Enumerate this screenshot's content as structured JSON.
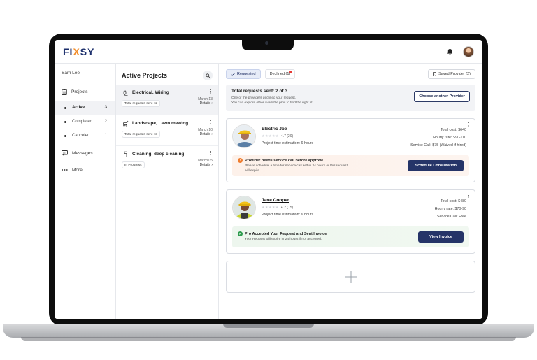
{
  "app": {
    "logo_left": "FI",
    "logo_x": "X",
    "logo_right": "SY",
    "accent": "#f28c28",
    "brand": "#1b2e6b"
  },
  "header": {
    "bell_icon": "bell-icon",
    "avatar_icon": "user-avatar"
  },
  "sidebar": {
    "user": "Sam Lee",
    "projects_label": "Projects",
    "statuses": [
      {
        "label": "Active",
        "count": "3"
      },
      {
        "label": "Completed",
        "count": "2"
      },
      {
        "label": "Canceled",
        "count": "1"
      }
    ],
    "messages_label": "Messages",
    "more_label": "More"
  },
  "projects": {
    "title": "Active Projects",
    "items": [
      {
        "name": "Electrical, Wiring",
        "date": "March 13",
        "chip": "Total requests sent : 2",
        "details": "Details"
      },
      {
        "name": "Landscape, Lawn mewing",
        "date": "March 10",
        "chip": "Total requests sent : 3",
        "details": "Details"
      },
      {
        "name": "Cleaning, deep cleaning",
        "date": "March 05",
        "chip": "In Progress",
        "details": "Details"
      }
    ]
  },
  "main": {
    "tabs": {
      "requested": "Requested",
      "declined": "Declined (1)",
      "saved": "Saved Provider (2)"
    },
    "banner": {
      "title": "Total requests sent: 2 of 3",
      "line1": "One of the providers declined your request.",
      "line2": "You can explore other available pros to find the right fit.",
      "button": "Choose another Provider"
    },
    "cards": [
      {
        "name": "Electric Joe",
        "rating": "4.7",
        "reviews": "(20)",
        "estimation": "Project time estimation: 6 hours",
        "total_cost": "Total cost: $640",
        "hourly": "Hourly rate: $90-110",
        "service": "Service Call: $75 (Waived if hired)",
        "alert_title": "Provider needs service call before approve",
        "alert_sub": "Please schedule a time for service call within 24 hours or this request will expire.",
        "button": "Schedule Consultation"
      },
      {
        "name": "Jane Cooper",
        "rating": "4.2",
        "reviews": "(15)",
        "estimation": "Project time estimation: 6 hours",
        "total_cost": "Total cost: $480",
        "hourly": "Hourly rate: $70-90",
        "service": "Service Call: Free",
        "alert_title": "Pro Accepted Your Request and Sent Invoice",
        "alert_sub": "Your Request will expire in 24 hours if not accepted.",
        "button": "View Invoice"
      }
    ]
  }
}
